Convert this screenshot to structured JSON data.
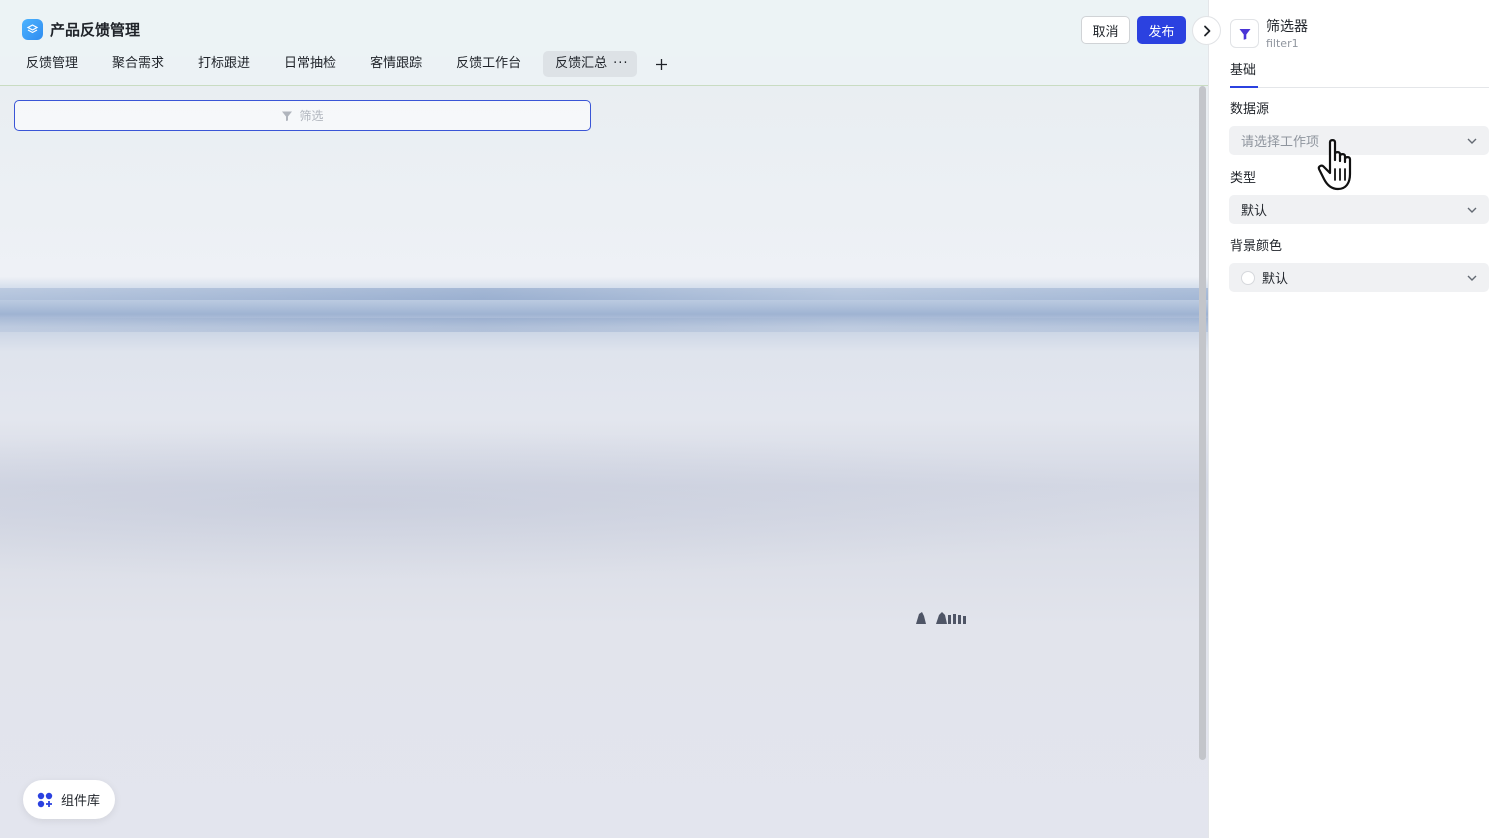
{
  "app": {
    "title": "产品反馈管理"
  },
  "toolbar": {
    "cancel_label": "取消",
    "publish_label": "发布"
  },
  "tabs": [
    {
      "label": "反馈管理"
    },
    {
      "label": "聚合需求"
    },
    {
      "label": "打标跟进"
    },
    {
      "label": "日常抽检"
    },
    {
      "label": "客情跟踪"
    },
    {
      "label": "反馈工作台"
    },
    {
      "label": "反馈汇总",
      "active": true,
      "more": "···"
    }
  ],
  "canvas": {
    "filter_placeholder": "筛选"
  },
  "component_library": {
    "label": "组件库"
  },
  "panel": {
    "title": "筛选器",
    "subtitle": "filter1",
    "tab": "基础",
    "fields": {
      "data_source": {
        "label": "数据源",
        "placeholder": "请选择工作项"
      },
      "type": {
        "label": "类型",
        "value": "默认"
      },
      "background_color": {
        "label": "背景颜色",
        "value": "默认"
      }
    }
  },
  "colors": {
    "accent": "#2b41e0",
    "filter_icon": "#4a34d6",
    "app_icon": "#2f8cf0"
  },
  "icons": [
    "app-logo-icon",
    "chevron-right-icon",
    "plus-icon",
    "funnel-icon",
    "component-library-icon",
    "chevron-down-icon",
    "hand-cursor-icon"
  ]
}
